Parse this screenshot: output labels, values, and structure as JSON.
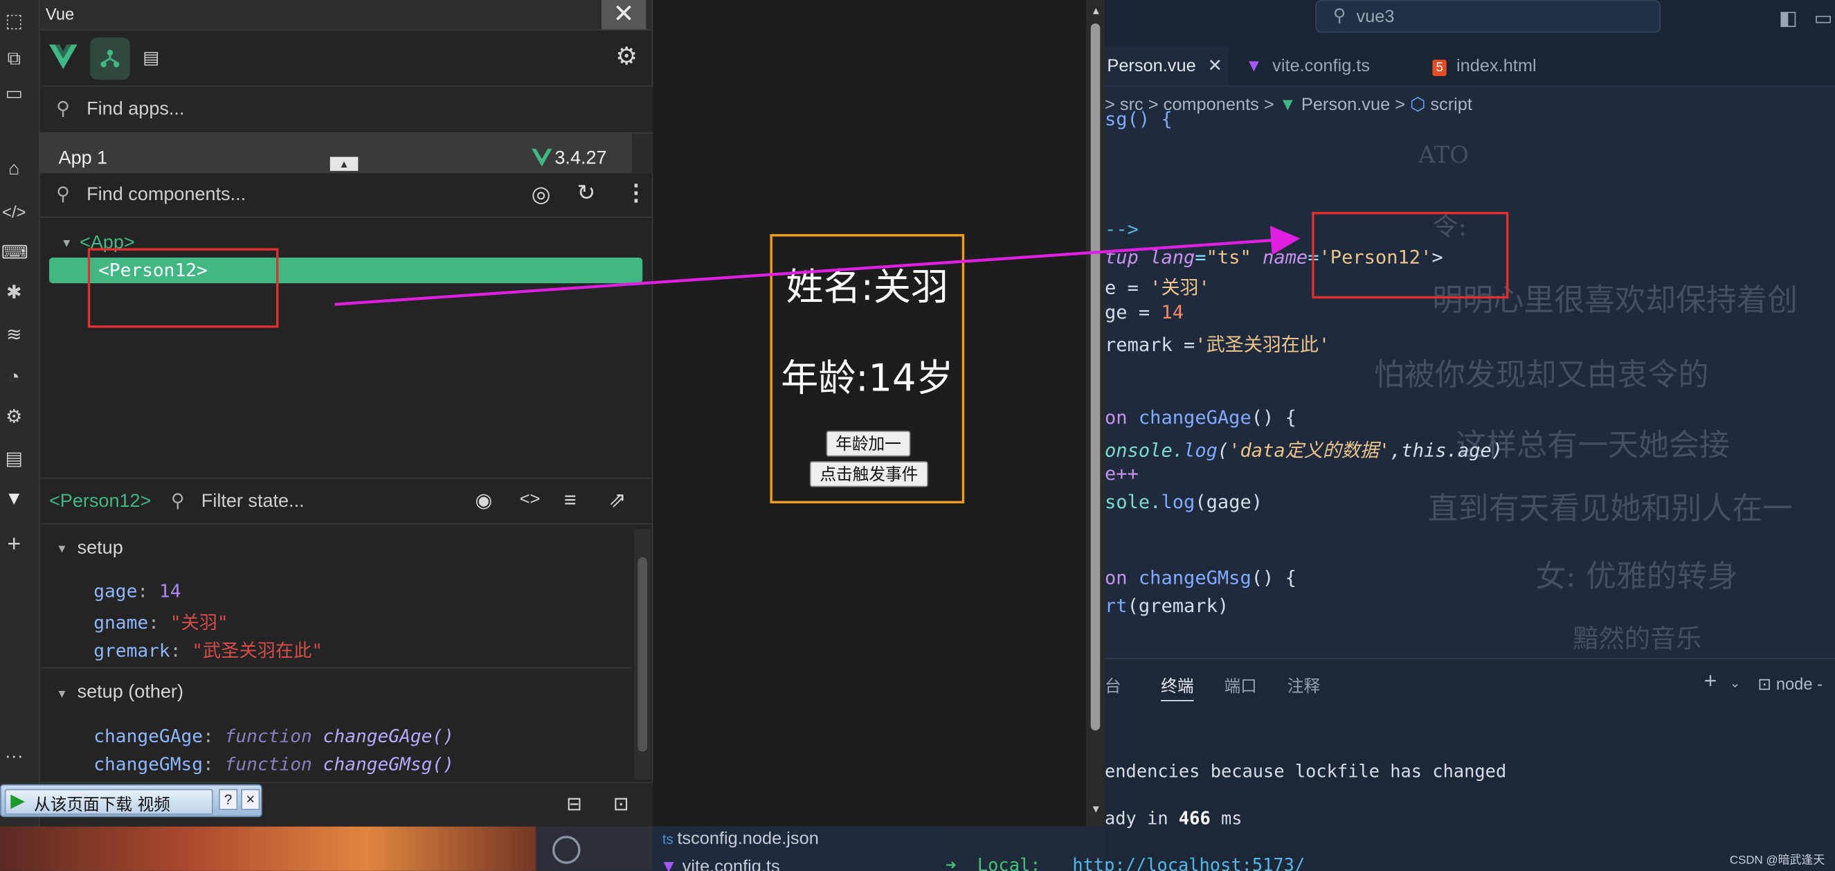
{
  "devtools": {
    "window_title": "Vue",
    "find_apps_placeholder": "Find apps...",
    "app_name": "App 1",
    "vue_version": "3.4.27",
    "find_components_placeholder": "Find components...",
    "tree_root": "<App>",
    "tree_selected": "<Person12>",
    "inspector_component": "<Person12>",
    "filter_state_placeholder": "Filter state...",
    "setup_section": "setup",
    "setup_state": [
      {
        "key": "gage",
        "value": "14"
      },
      {
        "key": "gname",
        "value": "\"关羽\""
      },
      {
        "key": "gremark",
        "value": "\"武圣关羽在此\""
      }
    ],
    "setup_other_section": "setup (other)",
    "setup_other": [
      {
        "key": "changeGAge",
        "kw": "function",
        "sig": "changeGAge()"
      },
      {
        "key": "changeGMsg",
        "kw": "function",
        "sig": "changeGMsg()"
      }
    ],
    "download_bar": "从该页面下载 视频",
    "download_help": "?",
    "download_close": "×"
  },
  "app": {
    "name_line": "姓名:关羽",
    "age_line": "年龄:14岁",
    "btn_age": "年龄加一",
    "btn_event": "点击触发事件"
  },
  "editor": {
    "search": "vue3",
    "tabs": [
      "Person.vue",
      "vite.config.ts",
      "index.html"
    ],
    "breadcrumb": [
      "src",
      "components",
      "Person.vue",
      "script"
    ],
    "code": {
      "l0": "sg() {",
      "l1": "-->",
      "l2_a": "tup ",
      "l2_b": "lang",
      "l2_c": "=",
      "l2_d": "\"ts\"",
      "l2_e": " name",
      "l2_f": "=",
      "l2_g": "'Person12'",
      "l2_h": ">",
      "l3_a": "e = ",
      "l3_b": "'关羽'",
      "l4_a": "ge = ",
      "l4_b": "14",
      "l5_a": "remark =",
      "l5_b": "'武圣关羽在此'",
      "l6_a": "on ",
      "l6_b": "changeGAge",
      "l6_c": "() {",
      "l7_a": "onsole.",
      "l7_b": "log",
      "l7_c": "(",
      "l7_d": "'data定义的数据'",
      "l7_e": ",this.age)",
      "l8": "e++",
      "l9_a": "sole.",
      "l9_b": "log",
      "l9_c": "(gage)",
      "l10_a": "on ",
      "l10_b": "changeGMsg",
      "l10_c": "() {",
      "l11_a": "rt",
      "l11_b": "(gremark)"
    },
    "ghost_lines": [
      "ATO",
      "令:",
      "明明心里很喜欢却保持着创",
      "怕被你发现却又由衷令的",
      "这样总有一天她会接",
      "直到有天看见她和别人在一",
      "女: 优雅的转身",
      "黯然的音乐"
    ],
    "panel_tabs": [
      "台",
      "终端",
      "端口",
      "注释"
    ],
    "panel_right": "node -",
    "terminal": {
      "line1": "endencies because lockfile has changed",
      "line2_a": "ady in ",
      "line2_b": "466",
      "line2_c": " ms",
      "line3_a": "➜  Local:",
      "line3_b": "http://localhost:5173/"
    },
    "explorer_peek": [
      "tsconfig.node.json",
      "vite.config.ts"
    ],
    "watermark": "CSDN @暗武逢天"
  },
  "colors": {
    "vue_green": "#41b883",
    "annotation_magenta": "#e020e0",
    "highlight_red": "#e03030",
    "card_orange": "#f29d18"
  }
}
